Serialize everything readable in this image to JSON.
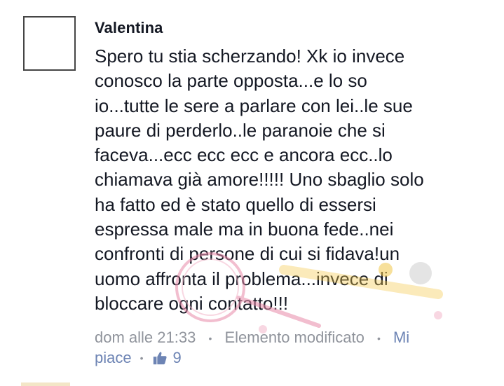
{
  "comment": {
    "author": "Valentina",
    "text_lines": [
      "Spero tu stia scherzando! Xk io invece",
      "conosco la parte opposta...e lo so",
      "io...tutte le sere a parlare con lei..le sue",
      "paure di perderlo..le paranoie che si",
      "faceva...ecc ecc ecc e ancora ecc..lo",
      "chiamava già amore!!!!! Uno sbaglio solo",
      "ha fatto ed è stato quello di essersi",
      "espressa male ma in buona fede..nei",
      "confronti di persone di cui si fidava!un",
      "uomo affronta il problema...invece di",
      "bloccare ogni contatto!!!"
    ],
    "timestamp": "dom alle 21:33",
    "separator": "•",
    "edited_label": "Elemento modificato",
    "like_link_part1": "Mi",
    "like_link_part2": "piace",
    "like_count": "9"
  },
  "colors": {
    "text": "#141823",
    "meta": "#90949c",
    "link": "#6d84b4",
    "watermark_pink": "#e88aa8",
    "watermark_yellow": "#f2c84b"
  },
  "icons": {
    "like": "thumbs-up-icon",
    "avatar": "avatar-placeholder"
  }
}
